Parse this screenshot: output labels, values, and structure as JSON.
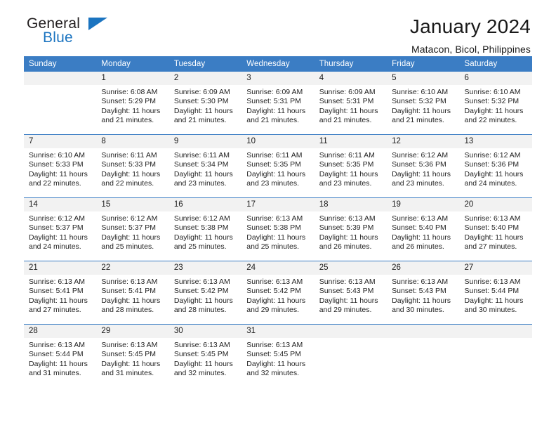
{
  "brand": {
    "name_dark": "General",
    "name_blue": "Blue",
    "accent_color": "#1b74c0"
  },
  "header": {
    "title": "January 2024",
    "subtitle": "Matacon, Bicol, Philippines"
  },
  "theme": {
    "header_blue": "#3b7dc4",
    "daynum_background": "#f2f2f2",
    "separator": "#3b7dc4"
  },
  "weekday_headers": [
    "Sunday",
    "Monday",
    "Tuesday",
    "Wednesday",
    "Thursday",
    "Friday",
    "Saturday"
  ],
  "labels": {
    "sunrise_prefix": "Sunrise:",
    "sunset_prefix": "Sunset:",
    "daylight_prefix": "Daylight:"
  },
  "weeks": [
    [
      {
        "day": "",
        "empty": true,
        "sunrise": "",
        "sunset": "",
        "daylight_line1": "",
        "daylight_line2": ""
      },
      {
        "day": "1",
        "sunrise": "Sunrise: 6:08 AM",
        "sunset": "Sunset: 5:29 PM",
        "daylight_line1": "Daylight: 11 hours",
        "daylight_line2": "and 21 minutes."
      },
      {
        "day": "2",
        "sunrise": "Sunrise: 6:09 AM",
        "sunset": "Sunset: 5:30 PM",
        "daylight_line1": "Daylight: 11 hours",
        "daylight_line2": "and 21 minutes."
      },
      {
        "day": "3",
        "sunrise": "Sunrise: 6:09 AM",
        "sunset": "Sunset: 5:31 PM",
        "daylight_line1": "Daylight: 11 hours",
        "daylight_line2": "and 21 minutes."
      },
      {
        "day": "4",
        "sunrise": "Sunrise: 6:09 AM",
        "sunset": "Sunset: 5:31 PM",
        "daylight_line1": "Daylight: 11 hours",
        "daylight_line2": "and 21 minutes."
      },
      {
        "day": "5",
        "sunrise": "Sunrise: 6:10 AM",
        "sunset": "Sunset: 5:32 PM",
        "daylight_line1": "Daylight: 11 hours",
        "daylight_line2": "and 21 minutes."
      },
      {
        "day": "6",
        "sunrise": "Sunrise: 6:10 AM",
        "sunset": "Sunset: 5:32 PM",
        "daylight_line1": "Daylight: 11 hours",
        "daylight_line2": "and 22 minutes."
      }
    ],
    [
      {
        "day": "7",
        "sunrise": "Sunrise: 6:10 AM",
        "sunset": "Sunset: 5:33 PM",
        "daylight_line1": "Daylight: 11 hours",
        "daylight_line2": "and 22 minutes."
      },
      {
        "day": "8",
        "sunrise": "Sunrise: 6:11 AM",
        "sunset": "Sunset: 5:33 PM",
        "daylight_line1": "Daylight: 11 hours",
        "daylight_line2": "and 22 minutes."
      },
      {
        "day": "9",
        "sunrise": "Sunrise: 6:11 AM",
        "sunset": "Sunset: 5:34 PM",
        "daylight_line1": "Daylight: 11 hours",
        "daylight_line2": "and 23 minutes."
      },
      {
        "day": "10",
        "sunrise": "Sunrise: 6:11 AM",
        "sunset": "Sunset: 5:35 PM",
        "daylight_line1": "Daylight: 11 hours",
        "daylight_line2": "and 23 minutes."
      },
      {
        "day": "11",
        "sunrise": "Sunrise: 6:11 AM",
        "sunset": "Sunset: 5:35 PM",
        "daylight_line1": "Daylight: 11 hours",
        "daylight_line2": "and 23 minutes."
      },
      {
        "day": "12",
        "sunrise": "Sunrise: 6:12 AM",
        "sunset": "Sunset: 5:36 PM",
        "daylight_line1": "Daylight: 11 hours",
        "daylight_line2": "and 23 minutes."
      },
      {
        "day": "13",
        "sunrise": "Sunrise: 6:12 AM",
        "sunset": "Sunset: 5:36 PM",
        "daylight_line1": "Daylight: 11 hours",
        "daylight_line2": "and 24 minutes."
      }
    ],
    [
      {
        "day": "14",
        "sunrise": "Sunrise: 6:12 AM",
        "sunset": "Sunset: 5:37 PM",
        "daylight_line1": "Daylight: 11 hours",
        "daylight_line2": "and 24 minutes."
      },
      {
        "day": "15",
        "sunrise": "Sunrise: 6:12 AM",
        "sunset": "Sunset: 5:37 PM",
        "daylight_line1": "Daylight: 11 hours",
        "daylight_line2": "and 25 minutes."
      },
      {
        "day": "16",
        "sunrise": "Sunrise: 6:12 AM",
        "sunset": "Sunset: 5:38 PM",
        "daylight_line1": "Daylight: 11 hours",
        "daylight_line2": "and 25 minutes."
      },
      {
        "day": "17",
        "sunrise": "Sunrise: 6:13 AM",
        "sunset": "Sunset: 5:38 PM",
        "daylight_line1": "Daylight: 11 hours",
        "daylight_line2": "and 25 minutes."
      },
      {
        "day": "18",
        "sunrise": "Sunrise: 6:13 AM",
        "sunset": "Sunset: 5:39 PM",
        "daylight_line1": "Daylight: 11 hours",
        "daylight_line2": "and 26 minutes."
      },
      {
        "day": "19",
        "sunrise": "Sunrise: 6:13 AM",
        "sunset": "Sunset: 5:40 PM",
        "daylight_line1": "Daylight: 11 hours",
        "daylight_line2": "and 26 minutes."
      },
      {
        "day": "20",
        "sunrise": "Sunrise: 6:13 AM",
        "sunset": "Sunset: 5:40 PM",
        "daylight_line1": "Daylight: 11 hours",
        "daylight_line2": "and 27 minutes."
      }
    ],
    [
      {
        "day": "21",
        "sunrise": "Sunrise: 6:13 AM",
        "sunset": "Sunset: 5:41 PM",
        "daylight_line1": "Daylight: 11 hours",
        "daylight_line2": "and 27 minutes."
      },
      {
        "day": "22",
        "sunrise": "Sunrise: 6:13 AM",
        "sunset": "Sunset: 5:41 PM",
        "daylight_line1": "Daylight: 11 hours",
        "daylight_line2": "and 28 minutes."
      },
      {
        "day": "23",
        "sunrise": "Sunrise: 6:13 AM",
        "sunset": "Sunset: 5:42 PM",
        "daylight_line1": "Daylight: 11 hours",
        "daylight_line2": "and 28 minutes."
      },
      {
        "day": "24",
        "sunrise": "Sunrise: 6:13 AM",
        "sunset": "Sunset: 5:42 PM",
        "daylight_line1": "Daylight: 11 hours",
        "daylight_line2": "and 29 minutes."
      },
      {
        "day": "25",
        "sunrise": "Sunrise: 6:13 AM",
        "sunset": "Sunset: 5:43 PM",
        "daylight_line1": "Daylight: 11 hours",
        "daylight_line2": "and 29 minutes."
      },
      {
        "day": "26",
        "sunrise": "Sunrise: 6:13 AM",
        "sunset": "Sunset: 5:43 PM",
        "daylight_line1": "Daylight: 11 hours",
        "daylight_line2": "and 30 minutes."
      },
      {
        "day": "27",
        "sunrise": "Sunrise: 6:13 AM",
        "sunset": "Sunset: 5:44 PM",
        "daylight_line1": "Daylight: 11 hours",
        "daylight_line2": "and 30 minutes."
      }
    ],
    [
      {
        "day": "28",
        "sunrise": "Sunrise: 6:13 AM",
        "sunset": "Sunset: 5:44 PM",
        "daylight_line1": "Daylight: 11 hours",
        "daylight_line2": "and 31 minutes."
      },
      {
        "day": "29",
        "sunrise": "Sunrise: 6:13 AM",
        "sunset": "Sunset: 5:45 PM",
        "daylight_line1": "Daylight: 11 hours",
        "daylight_line2": "and 31 minutes."
      },
      {
        "day": "30",
        "sunrise": "Sunrise: 6:13 AM",
        "sunset": "Sunset: 5:45 PM",
        "daylight_line1": "Daylight: 11 hours",
        "daylight_line2": "and 32 minutes."
      },
      {
        "day": "31",
        "sunrise": "Sunrise: 6:13 AM",
        "sunset": "Sunset: 5:45 PM",
        "daylight_line1": "Daylight: 11 hours",
        "daylight_line2": "and 32 minutes."
      },
      {
        "day": "",
        "empty": true,
        "sunrise": "",
        "sunset": "",
        "daylight_line1": "",
        "daylight_line2": ""
      },
      {
        "day": "",
        "empty": true,
        "sunrise": "",
        "sunset": "",
        "daylight_line1": "",
        "daylight_line2": ""
      },
      {
        "day": "",
        "empty": true,
        "sunrise": "",
        "sunset": "",
        "daylight_line1": "",
        "daylight_line2": ""
      }
    ]
  ]
}
